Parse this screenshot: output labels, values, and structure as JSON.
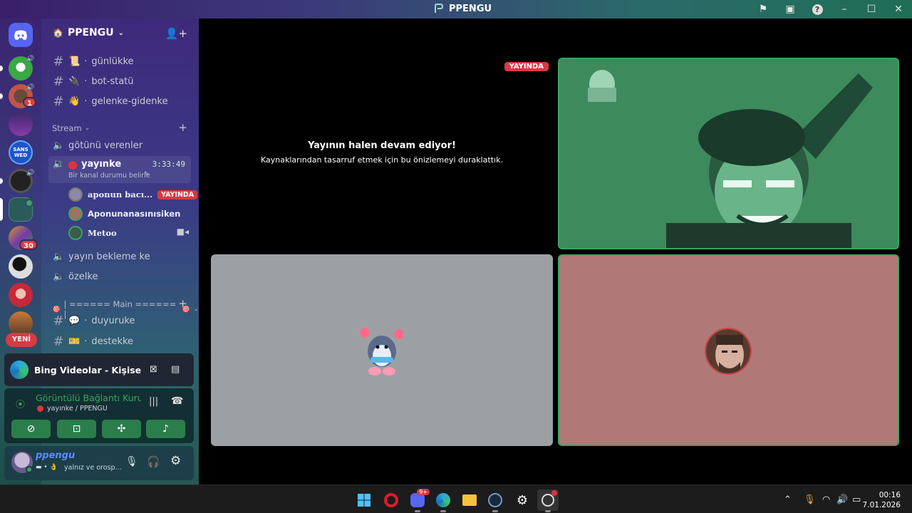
{
  "window": {
    "title": "PPENGU"
  },
  "server": {
    "name": "PPENGU"
  },
  "rail": {
    "badges": [
      "1",
      "30"
    ],
    "new_label": "YENİ"
  },
  "channels": {
    "text_top": [
      {
        "emoji": "📜",
        "name": "günlükke"
      },
      {
        "emoji": "🔌",
        "name": "bot-statü"
      },
      {
        "emoji": "👋",
        "name": "gelenke-gidenke"
      }
    ],
    "category_stream": "Stream",
    "voice_stream": [
      {
        "name": "götünü verenler"
      },
      {
        "name": "yayınke",
        "timer": "3:33:49",
        "status": "Bir kanal durumu belirle"
      },
      {
        "name": "yayın bekleme ke"
      },
      {
        "name": "özelke"
      }
    ],
    "voice_users": [
      {
        "name": "aponun bacı...",
        "badge": "YAYINDA"
      },
      {
        "name": "Aponunanasınısiken"
      },
      {
        "name": "Metoo"
      }
    ],
    "category_main": "| ====== Main ====== |",
    "text_main": [
      {
        "emoji": "💬",
        "name": "duyuruke"
      },
      {
        "emoji": "🎫",
        "name": "destekke"
      }
    ]
  },
  "activity": {
    "title": "Bing Videolar - Kişisel - ..."
  },
  "voice_connection": {
    "status": "Görüntülü Bağlantı Kurulc",
    "location": "yayınke / PPENGU"
  },
  "user": {
    "name": "ppengu",
    "status": "yalnız ve orosp..."
  },
  "stream": {
    "live_badge": "YAYINDA",
    "paused_title": "Yayının halen devam ediyor!",
    "paused_sub": "Kaynaklarından tasarruf etmek için bu önizlemeyi duraklattık."
  },
  "taskbar": {
    "discord_badge": "9+",
    "time": "00:16",
    "date": "7.01.2026"
  },
  "colors": {
    "live_red": "#d83a42",
    "speaking_green": "#3ba55c",
    "tile_gray": "#9da0a3",
    "tile_pink": "#b17878"
  }
}
